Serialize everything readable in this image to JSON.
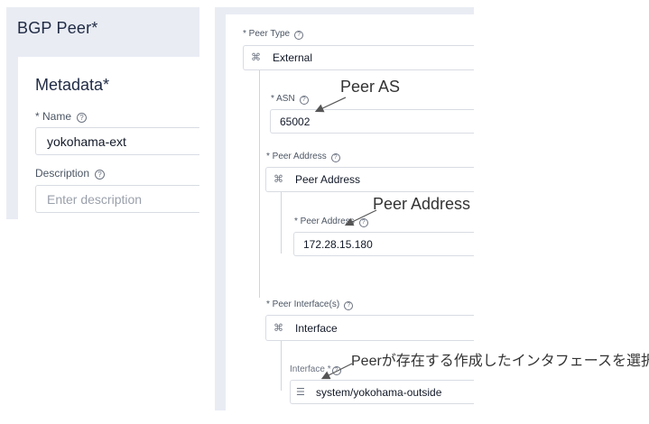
{
  "left": {
    "panel_title": "BGP Peer*",
    "metadata_title": "Metadata*",
    "name_label": "* Name",
    "name_value": "yokohama-ext",
    "description_label": "Description",
    "description_placeholder": "Enter description"
  },
  "right": {
    "peer_type_label": "* Peer Type",
    "peer_type_value": "External",
    "asn_label": "* ASN",
    "asn_value": "65002",
    "peer_address_section_label": "* Peer Address",
    "peer_address_header": "Peer Address",
    "peer_address_field_label": "* Peer Address",
    "peer_address_value": "172.28.15.180",
    "peer_interfaces_label": "* Peer Interface(s)",
    "interface_header": "Interface",
    "interface_field_label": "Interface *",
    "interface_value": "system/yokohama-outside"
  },
  "annotations": {
    "peer_as": "Peer AS",
    "peer_address": "Peer Address",
    "interface_note": "Peerが存在する作成したインタフェースを選択"
  },
  "icons": {
    "type_icon": "tree-structure-icon",
    "help_icon": "question-circle-icon",
    "interface_icon": "list-icon"
  }
}
